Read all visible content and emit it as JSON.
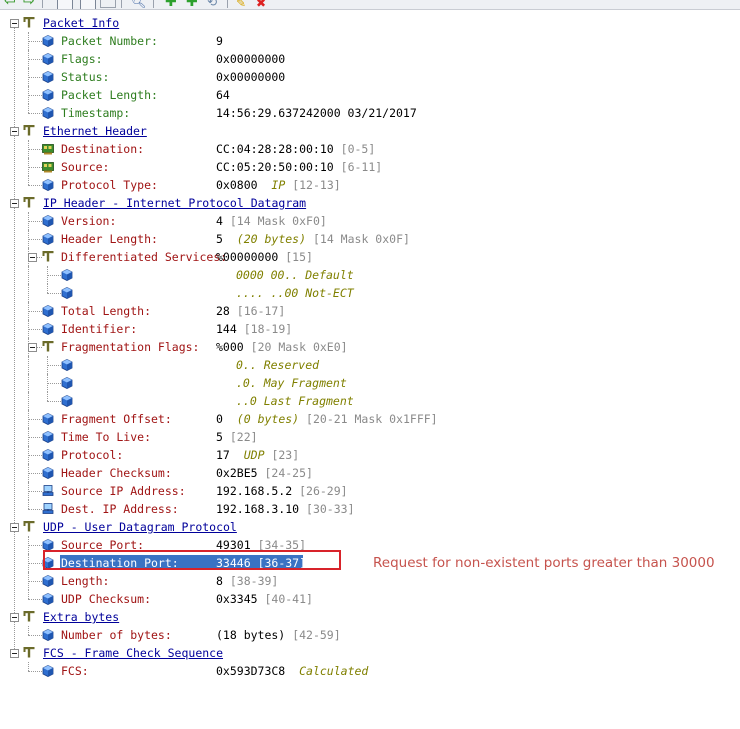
{
  "toolbar": {
    "icons": [
      "back-arrow-icon",
      "forward-arrow-icon",
      "decode-view-icon",
      "hex-view-icon",
      "grid-view-icon",
      "search-icon",
      "add-icon",
      "add-alt-icon",
      "refresh-icon",
      "edit-icon",
      "delete-icon"
    ]
  },
  "colors": {
    "header_link": "#00009a",
    "label_green": "#2e7d1f",
    "label_red": "#a01414",
    "note_olive": "#808000",
    "range_gray": "#8a8a8a",
    "selection": "#3a73c4",
    "highlight_box": "#d8232a"
  },
  "tree": [
    {
      "kind": "group",
      "label": "Packet Info"
    },
    {
      "kind": "field",
      "label": "Packet Number:",
      "color": "green",
      "value": "9"
    },
    {
      "kind": "field",
      "label": "Flags:",
      "color": "green",
      "value": "0x00000000"
    },
    {
      "kind": "field",
      "label": "Status:",
      "color": "green",
      "value": "0x00000000"
    },
    {
      "kind": "field",
      "label": "Packet Length:",
      "color": "green",
      "value": "64"
    },
    {
      "kind": "field",
      "label": "Timestamp:",
      "color": "green",
      "value": "14:56:29.637242000 03/21/2017",
      "last": true
    },
    {
      "kind": "group",
      "label": "Ethernet Header"
    },
    {
      "kind": "field",
      "icon": "nic",
      "label": "Destination:",
      "color": "red",
      "value": "CC:04:28:28:00:10",
      "range": "[0-5]"
    },
    {
      "kind": "field",
      "icon": "nic",
      "label": "Source:",
      "color": "red",
      "value": "CC:05:20:50:00:10",
      "range": "[6-11]"
    },
    {
      "kind": "field",
      "label": "Protocol Type:",
      "color": "red",
      "value": "0x0800",
      "note": "IP",
      "range": "[12-13]",
      "last": true
    },
    {
      "kind": "group",
      "label": "IP Header - Internet Protocol Datagram"
    },
    {
      "kind": "field",
      "label": "Version:",
      "color": "red",
      "value": "4",
      "range": "[14 Mask 0xF0]"
    },
    {
      "kind": "field",
      "label": "Header Length:",
      "color": "red",
      "value": "5",
      "note": "(20 bytes)",
      "range": "[14 Mask 0x0F]"
    },
    {
      "kind": "subgroup",
      "label": "Differentiated Services:",
      "color": "red",
      "value": "%00000000",
      "range": "[15]"
    },
    {
      "kind": "bit",
      "note": "0000 00.. Default"
    },
    {
      "kind": "bit",
      "note": ".... ..00 Not-ECT",
      "last": true
    },
    {
      "kind": "field",
      "label": "Total Length:",
      "color": "red",
      "value": "28",
      "range": "[16-17]"
    },
    {
      "kind": "field",
      "label": "Identifier:",
      "color": "red",
      "value": "144",
      "range": "[18-19]"
    },
    {
      "kind": "subgroup",
      "label": "Fragmentation Flags:",
      "color": "red",
      "value": "%000",
      "range": "[20 Mask 0xE0]"
    },
    {
      "kind": "bit",
      "note": "0.. Reserved"
    },
    {
      "kind": "bit",
      "note": ".0. May Fragment"
    },
    {
      "kind": "bit",
      "note": "..0 Last Fragment",
      "last": true
    },
    {
      "kind": "field",
      "label": "Fragment Offset:",
      "color": "red",
      "value": "0",
      "note": "(0 bytes)",
      "range": "[20-21 Mask 0x1FFF]"
    },
    {
      "kind": "field",
      "label": "Time To Live:",
      "color": "red",
      "value": "5",
      "range": "[22]"
    },
    {
      "kind": "field",
      "label": "Protocol:",
      "color": "red",
      "value": "17",
      "note": "UDP",
      "range": "[23]"
    },
    {
      "kind": "field",
      "label": "Header Checksum:",
      "color": "red",
      "value": "0x2BE5",
      "range": "[24-25]"
    },
    {
      "kind": "field",
      "icon": "host",
      "label": "Source IP Address:",
      "color": "red",
      "value": "192.168.5.2",
      "range": "[26-29]"
    },
    {
      "kind": "field",
      "icon": "host",
      "label": "Dest. IP Address:",
      "color": "red",
      "value": "192.168.3.10",
      "range": "[30-33]",
      "last": true
    },
    {
      "kind": "group",
      "label": "UDP - User Datagram Protocol"
    },
    {
      "kind": "field",
      "label": "Source Port:",
      "color": "red",
      "value": "49301",
      "range": "[34-35]"
    },
    {
      "kind": "field",
      "label": "Destination Port:",
      "color": "red",
      "value": "33446",
      "range": "[36-37]",
      "selected": true
    },
    {
      "kind": "field",
      "label": "Length:",
      "color": "red",
      "value": "8",
      "range": "[38-39]"
    },
    {
      "kind": "field",
      "label": "UDP Checksum:",
      "color": "red",
      "value": "0x3345",
      "range": "[40-41]",
      "last": true
    },
    {
      "kind": "group",
      "label": "Extra bytes"
    },
    {
      "kind": "field",
      "label": "Number of bytes:",
      "color": "red",
      "value": "(18 bytes)",
      "range": "[42-59]",
      "last": true
    },
    {
      "kind": "group",
      "label": "FCS - Frame Check Sequence",
      "lastgroup": true
    },
    {
      "kind": "field",
      "label": "FCS:",
      "color": "red",
      "value": "0x593D73C8",
      "note": "Calculated",
      "last": true
    }
  ],
  "annotation": "Request for non-existent ports greater than 30000"
}
